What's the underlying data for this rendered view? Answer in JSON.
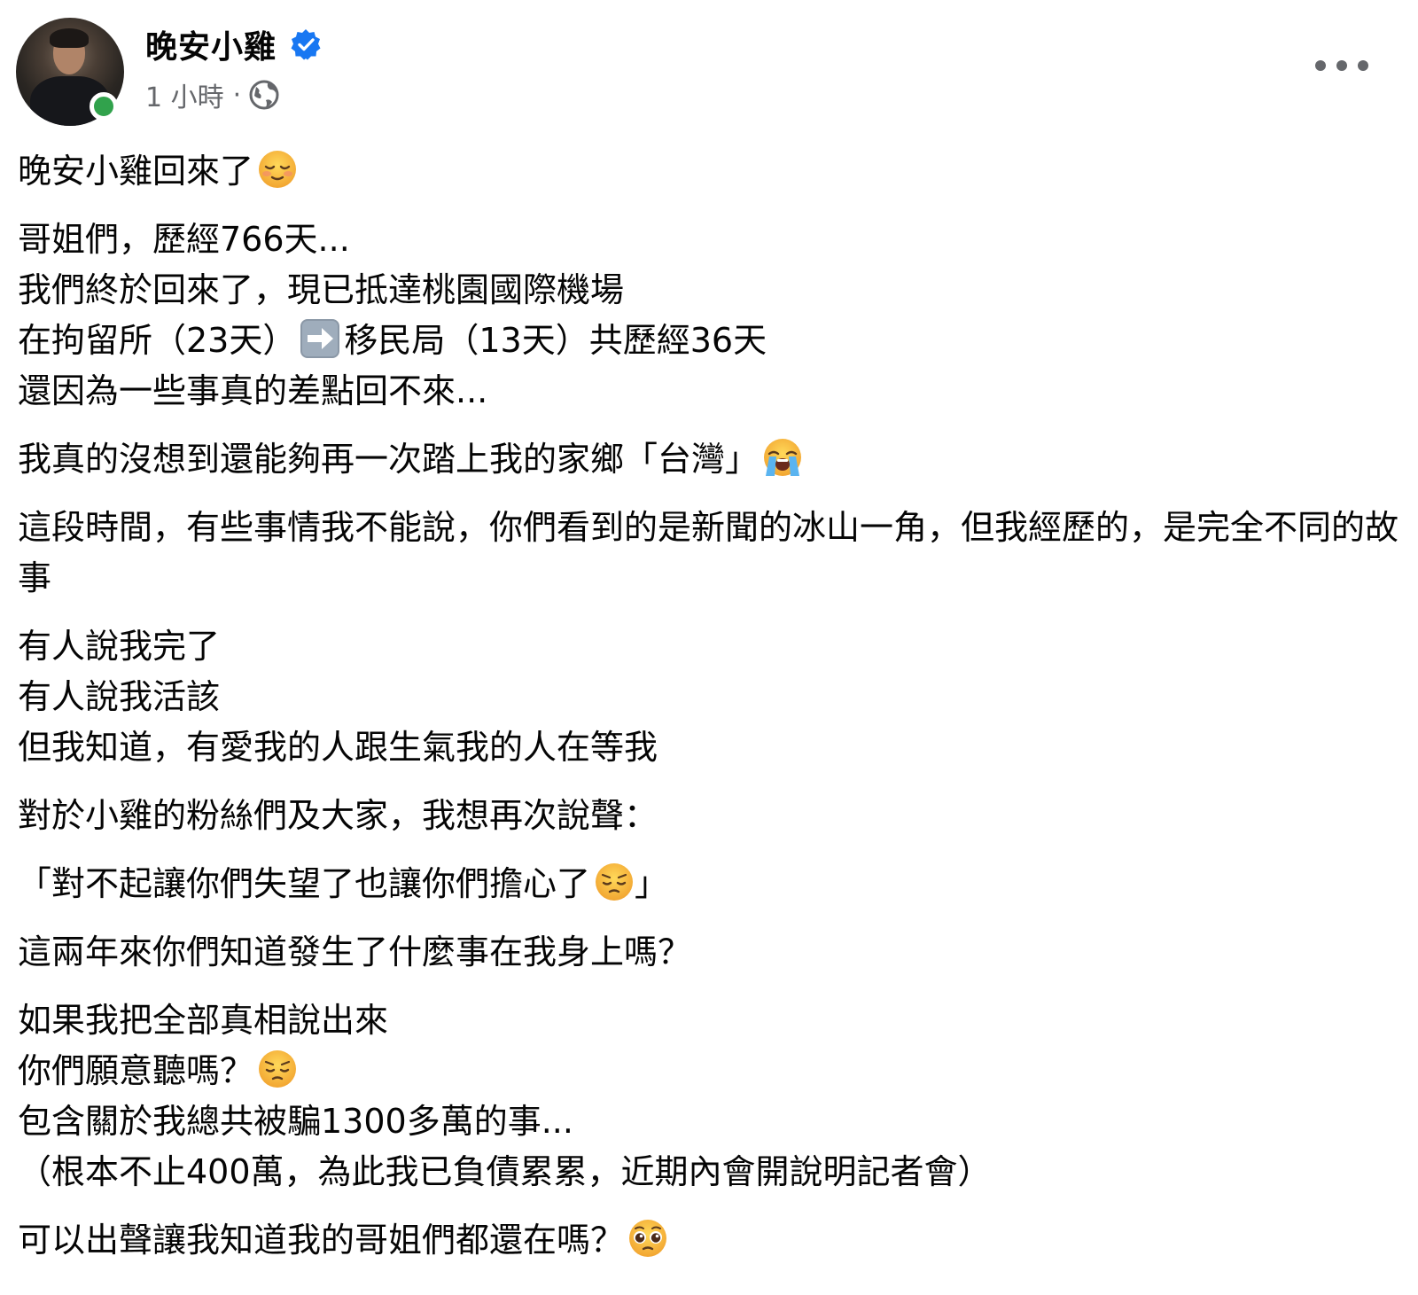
{
  "post": {
    "author": "晚安小雞",
    "time": "1 小時",
    "separator": "·",
    "privacy_icon": "globe-icon",
    "verified_icon": "verified-badge-icon",
    "more_icon": "more-options-icon"
  },
  "colors": {
    "text": "#050505",
    "meta": "#65676b",
    "verified": "#1877f2",
    "online": "#31a24c"
  },
  "body": {
    "p1": [
      "晚安小雞回來了"
    ],
    "p2": [
      "哥姐們，歷經766天...",
      "我們終於回來了，現已抵達桃園國際機場",
      [
        "在拘留所（23天）",
        "移民局（13天）共歷經36天"
      ],
      "還因為一些事真的差點回不來..."
    ],
    "p3": "我真的沒想到還能夠再一次踏上我的家鄉「台灣」",
    "p4": "這段時間，有些事情我不能說，你們看到的是新聞的冰山一角，但我經歷的，是完全不同的故事",
    "p5": [
      "有人說我完了",
      "有人說我活該",
      "但我知道，有愛我的人跟生氣我的人在等我"
    ],
    "p6": "對於小雞的粉絲們及大家，我想再次說聲：",
    "p7": [
      "「對不起讓你們失望了也讓你們擔心了",
      "」"
    ],
    "p8": "這兩年來你們知道發生了什麼事在我身上嗎？",
    "p9": [
      "如果我把全部真相說出來",
      "你們願意聽嗎？",
      "包含關於我總共被騙1300多萬的事...",
      "（根本不止400萬，為此我已負債累累，近期內會開說明記者會）"
    ],
    "p10": "可以出聲讓我知道我的哥姐們都還在嗎？"
  },
  "emojis": {
    "relieved": "relieved-face-emoji",
    "arrow": "right-arrow-emoji",
    "crying": "loudly-crying-face-emoji",
    "pensive": "pensive-face-emoji",
    "pleading": "pleading-face-emoji"
  }
}
